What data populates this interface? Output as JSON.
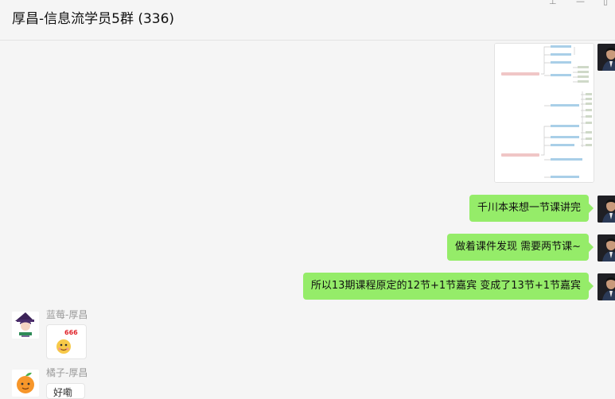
{
  "window": {
    "title": "厚昌-信息流学员5群 (336)",
    "controls": {
      "pin": "⊥",
      "minimize": "—",
      "maximize": "▯"
    }
  },
  "messages": [
    {
      "type": "image",
      "from": "self",
      "icon": "mindmap-image"
    },
    {
      "type": "text",
      "from": "self",
      "text": "千川本来想一节课讲完"
    },
    {
      "type": "text",
      "from": "self",
      "text": "做着课件发现 需要两节课~"
    },
    {
      "type": "text",
      "from": "self",
      "text": "所以13期课程原定的12节+1节嘉宾  变成了13节+1节嘉宾"
    },
    {
      "type": "sticker",
      "from": "蓝莓-厚昌",
      "sender_name": "蓝莓-厚昌",
      "sticker_label": "666",
      "icon": "emoji-666-sticker"
    },
    {
      "type": "text",
      "from": "橘子-厚昌",
      "sender_name": "橘子-厚昌",
      "text": "好嘞"
    }
  ],
  "colors": {
    "self_bubble": "#95ec69",
    "background": "#f5f5f5",
    "self_avatar_bg": "#1f1f24"
  }
}
